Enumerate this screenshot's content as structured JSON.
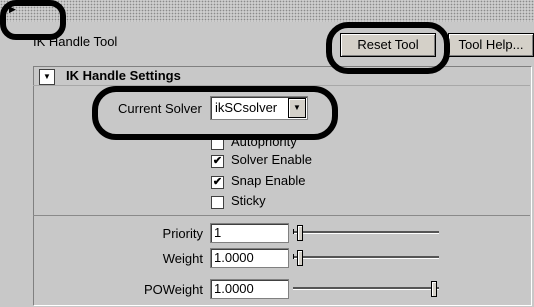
{
  "title_bar": {
    "collapse_arrow_icon": "right-triangle-icon"
  },
  "toolbar": {
    "tool_title": "IK Handle Tool",
    "reset_label": "Reset Tool",
    "help_label": "Tool Help..."
  },
  "section": {
    "title": "IK Handle Settings",
    "collapse_icon": "down-triangle-icon"
  },
  "solver": {
    "label": "Current Solver",
    "value": "ikSCsolver"
  },
  "checkboxes": [
    {
      "label": "Autopriority",
      "checked": false,
      "mark": ""
    },
    {
      "label": "Solver Enable",
      "checked": true,
      "mark": "✔"
    },
    {
      "label": "Snap Enable",
      "checked": true,
      "mark": "✔"
    },
    {
      "label": "Sticky",
      "checked": false,
      "mark": ""
    }
  ],
  "fields": [
    {
      "label": "Priority",
      "value": "1",
      "slider_fraction": 0.0
    },
    {
      "label": "Weight",
      "value": "1.0000",
      "slider_fraction": 0.0
    },
    {
      "label": "POWeight",
      "value": "1.0000",
      "slider_fraction": 1.0
    }
  ]
}
